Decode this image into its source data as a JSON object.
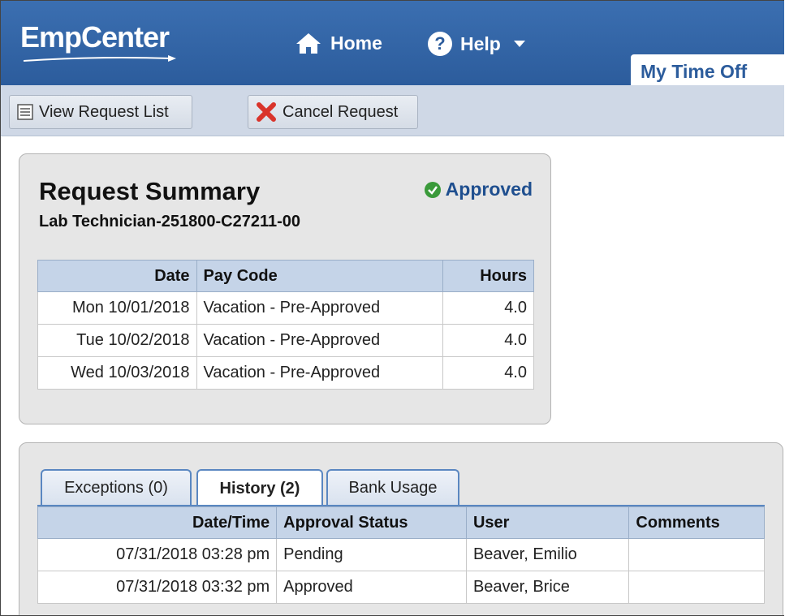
{
  "header": {
    "logo": "EmpCenter",
    "nav": {
      "home_label": "Home",
      "help_label": "Help"
    },
    "active_tab": "My Time Off"
  },
  "toolbar": {
    "view_request_list_label": "View Request List",
    "cancel_request_label": "Cancel Request"
  },
  "summary": {
    "title": "Request Summary",
    "subtitle": "Lab Technician-251800-C27211-00",
    "status": "Approved",
    "status_color": "#3a9a3a",
    "columns": {
      "date": "Date",
      "pay_code": "Pay Code",
      "hours": "Hours"
    },
    "rows": [
      {
        "date": "Mon 10/01/2018",
        "pay_code": "Vacation - Pre-Approved",
        "hours": "4.0"
      },
      {
        "date": "Tue 10/02/2018",
        "pay_code": "Vacation - Pre-Approved",
        "hours": "4.0"
      },
      {
        "date": "Wed 10/03/2018",
        "pay_code": "Vacation - Pre-Approved",
        "hours": "4.0"
      }
    ]
  },
  "history": {
    "tabs": {
      "exceptions": "Exceptions (0)",
      "history": "History (2)",
      "bank_usage": "Bank Usage"
    },
    "active_tab": "History (2)",
    "columns": {
      "datetime": "Date/Time",
      "approval_status": "Approval Status",
      "user": "User",
      "comments": "Comments"
    },
    "rows": [
      {
        "datetime": "07/31/2018 03:28 pm",
        "approval_status": "Pending",
        "user": "Beaver, Emilio",
        "comments": ""
      },
      {
        "datetime": "07/31/2018 03:32 pm",
        "approval_status": "Approved",
        "user": "Beaver, Brice",
        "comments": ""
      }
    ]
  },
  "colors": {
    "header_blue": "#2c5c9c",
    "toolbar_bg": "#cfd8e6",
    "table_header_bg": "#c5d4e8"
  }
}
